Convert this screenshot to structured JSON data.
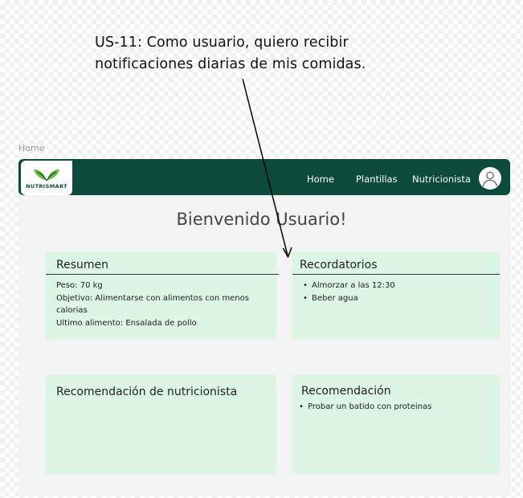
{
  "annotation": {
    "text": "US-11: Como usuario, quiero recibir\nnotificaciones diarias de mis comidas."
  },
  "frame": {
    "label": "Home"
  },
  "navbar": {
    "logo_text": "NUTRISMART",
    "links": [
      "Home",
      "Plantillas",
      "Nutricionista"
    ],
    "avatar_icon": "user-icon"
  },
  "main": {
    "welcome": "Bienvenido Usuario!"
  },
  "resumen": {
    "title": "Resumen",
    "lines": [
      "Peso: 70 kg",
      "Objetivo: Alimentarse con alimentos con menos calorias",
      "Ultimo alimento: Ensalada de pollo"
    ]
  },
  "recordatorios": {
    "title": "Recordatorios",
    "items": [
      "Almorzar a las 12:30",
      "Beber agua"
    ]
  },
  "recomendacion_nutricionista": {
    "title": "Recomendación de nutricionista"
  },
  "recomendacion": {
    "title": "Recomendación",
    "items": [
      "Probar un batido con proteinas"
    ]
  },
  "colors": {
    "navbar": "#0c4a39",
    "card": "#dcf5e5",
    "frame": "#f1f4f3"
  }
}
